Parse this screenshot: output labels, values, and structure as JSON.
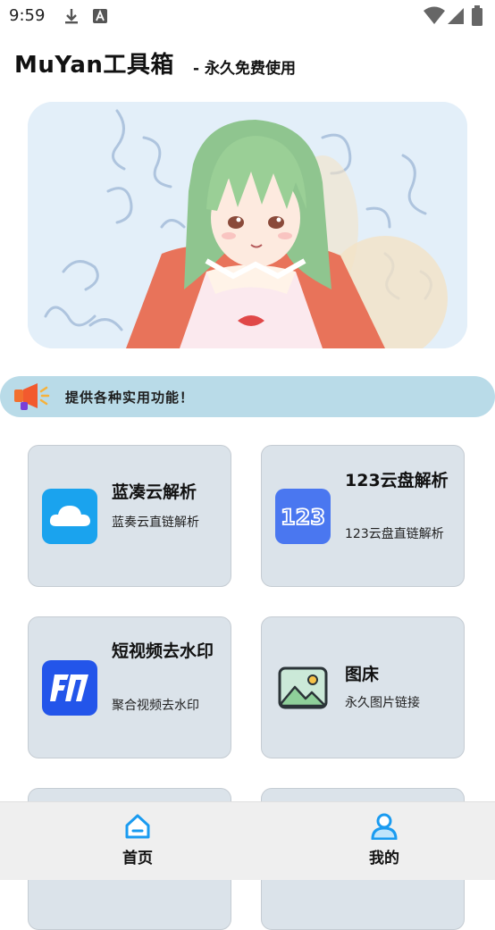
{
  "status_bar": {
    "time": "9:59"
  },
  "header": {
    "title": "MuYan工具箱",
    "subtitle": "- 永久免费使用"
  },
  "notice": {
    "text": "提供各种实用功能！"
  },
  "tools": [
    {
      "title": "蓝凑云解析",
      "desc": "蓝奏云直链解析",
      "icon": "cloud-icon"
    },
    {
      "title": "123云盘解析",
      "desc": "123云盘直链解析",
      "icon": "123-icon"
    },
    {
      "title": "短视频去水印",
      "desc": "聚合视频去水印",
      "icon": "video-icon"
    },
    {
      "title": "图床",
      "desc": "永久图片链接",
      "icon": "image-icon"
    }
  ],
  "nav": {
    "home_label": "首页",
    "mine_label": "我的"
  },
  "colors": {
    "accent": "#1a9bf0",
    "card_bg": "#dbe3ea",
    "notice_bg": "#b9dbe8",
    "nav_bg": "#efefef"
  }
}
